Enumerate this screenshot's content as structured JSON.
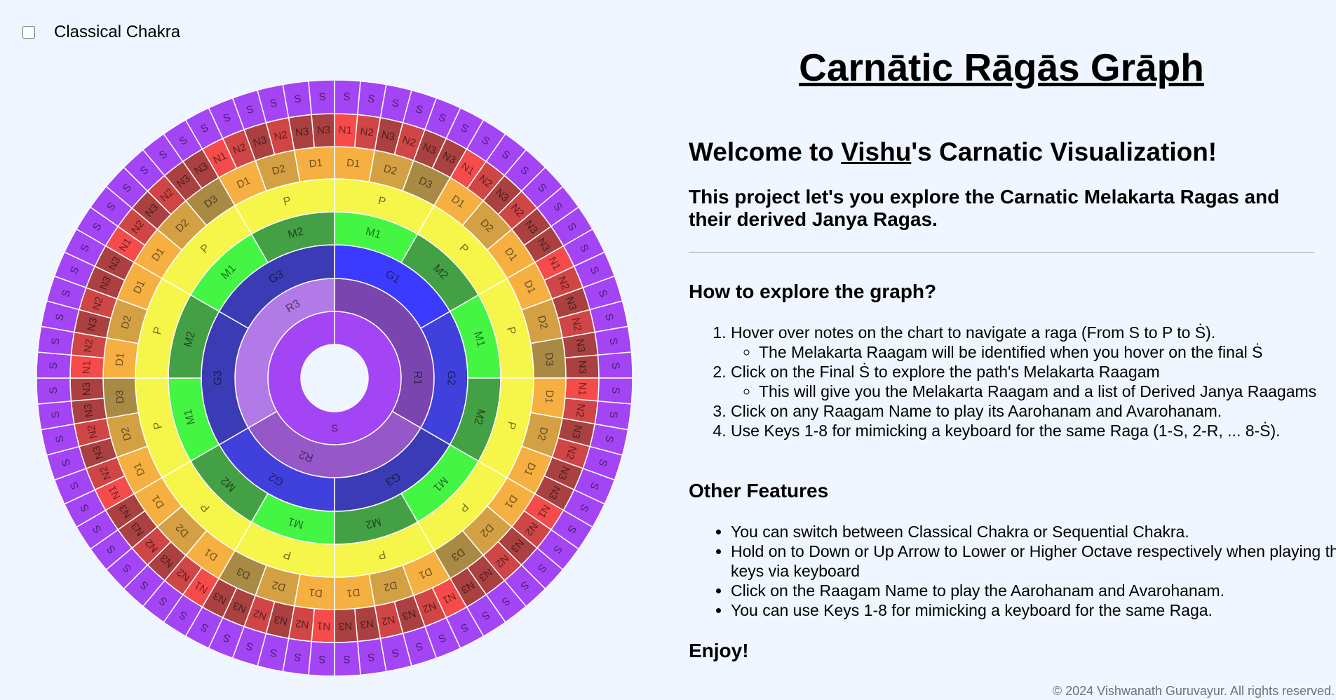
{
  "toggle": {
    "label": "Classical Chakra",
    "checked": false
  },
  "title": "Carnātic Rāgās Grāph",
  "welcome": {
    "prefix": "Welcome to ",
    "name": "Vishu",
    "suffix": "'s Carnatic Visualization!"
  },
  "intro": "This project let's you explore the Carnatic Melakarta Ragas and their derived Janya Ragas.",
  "how_heading": "How to explore the graph?",
  "how_steps": [
    {
      "text": "Hover over notes on the chart to navigate a raga (From S to P to Ṡ).",
      "sub": "The Melakarta Raagam will be identified when you hover on the final Ṡ"
    },
    {
      "text": "Click on the Final Ṡ to explore the path's Melakarta Raagam",
      "sub": "This will give you the Melakarta Raagam and a list of Derived Janya Raagams"
    },
    {
      "text": "Click on any Raagam Name to play its Aarohanam and Avarohanam."
    },
    {
      "text": "Use Keys 1-8 for mimicking a keyboard for the same Raga (1-S, 2-R, ... 8-Ṡ)."
    }
  ],
  "other_heading": "Other Features",
  "other_features": [
    "You can switch between Classical Chakra or Sequential Chakra.",
    "Hold on to Down or Up Arrow to Lower or Higher Octave respectively when playing the keys via keyboard",
    "Click on the Raagam Name to play the Aarohanam and Avarohanam.",
    "You can use Keys 1-8 for mimicking a keyboard for the same Raga."
  ],
  "enjoy": "Enjoy!",
  "footer": "© 2024 Vishwanath Guruvayur. All rights reserved.",
  "colors": {
    "S": "#a344f5",
    "R1": "#7b45b0",
    "R2": "#9657c9",
    "R3": "#b27ae6",
    "G1": "#3b3bff",
    "G2": "#4040dd",
    "G3": "#3b3bb5",
    "M1": "#44f544",
    "M2": "#44a044",
    "P": "#f5f54a",
    "D1": "#f5b041",
    "D2": "#d4a044",
    "D3": "#a88a44",
    "N1": "#f54b4b",
    "N2": "#d04545",
    "N3": "#aa4040",
    "background": "#eff6ff"
  },
  "wheel": {
    "ring1": [
      "S"
    ],
    "ring2": [
      "R1",
      "R2",
      "R3"
    ],
    "ring3": [
      "G1",
      "G2",
      "G3",
      "G2",
      "G3",
      "G3"
    ],
    "ring4": [
      "M1",
      "M2",
      "M1",
      "M2",
      "M1",
      "M2",
      "M1",
      "M2",
      "M1",
      "M2",
      "M1",
      "M2"
    ],
    "ring5_note": "P",
    "ring6": [
      "D1",
      "D2",
      "D3",
      "D1",
      "D2",
      "D1"
    ],
    "ring7": [
      "N1",
      "N2",
      "N3",
      "N2",
      "N3",
      "N3"
    ],
    "ring8_note": "S"
  }
}
